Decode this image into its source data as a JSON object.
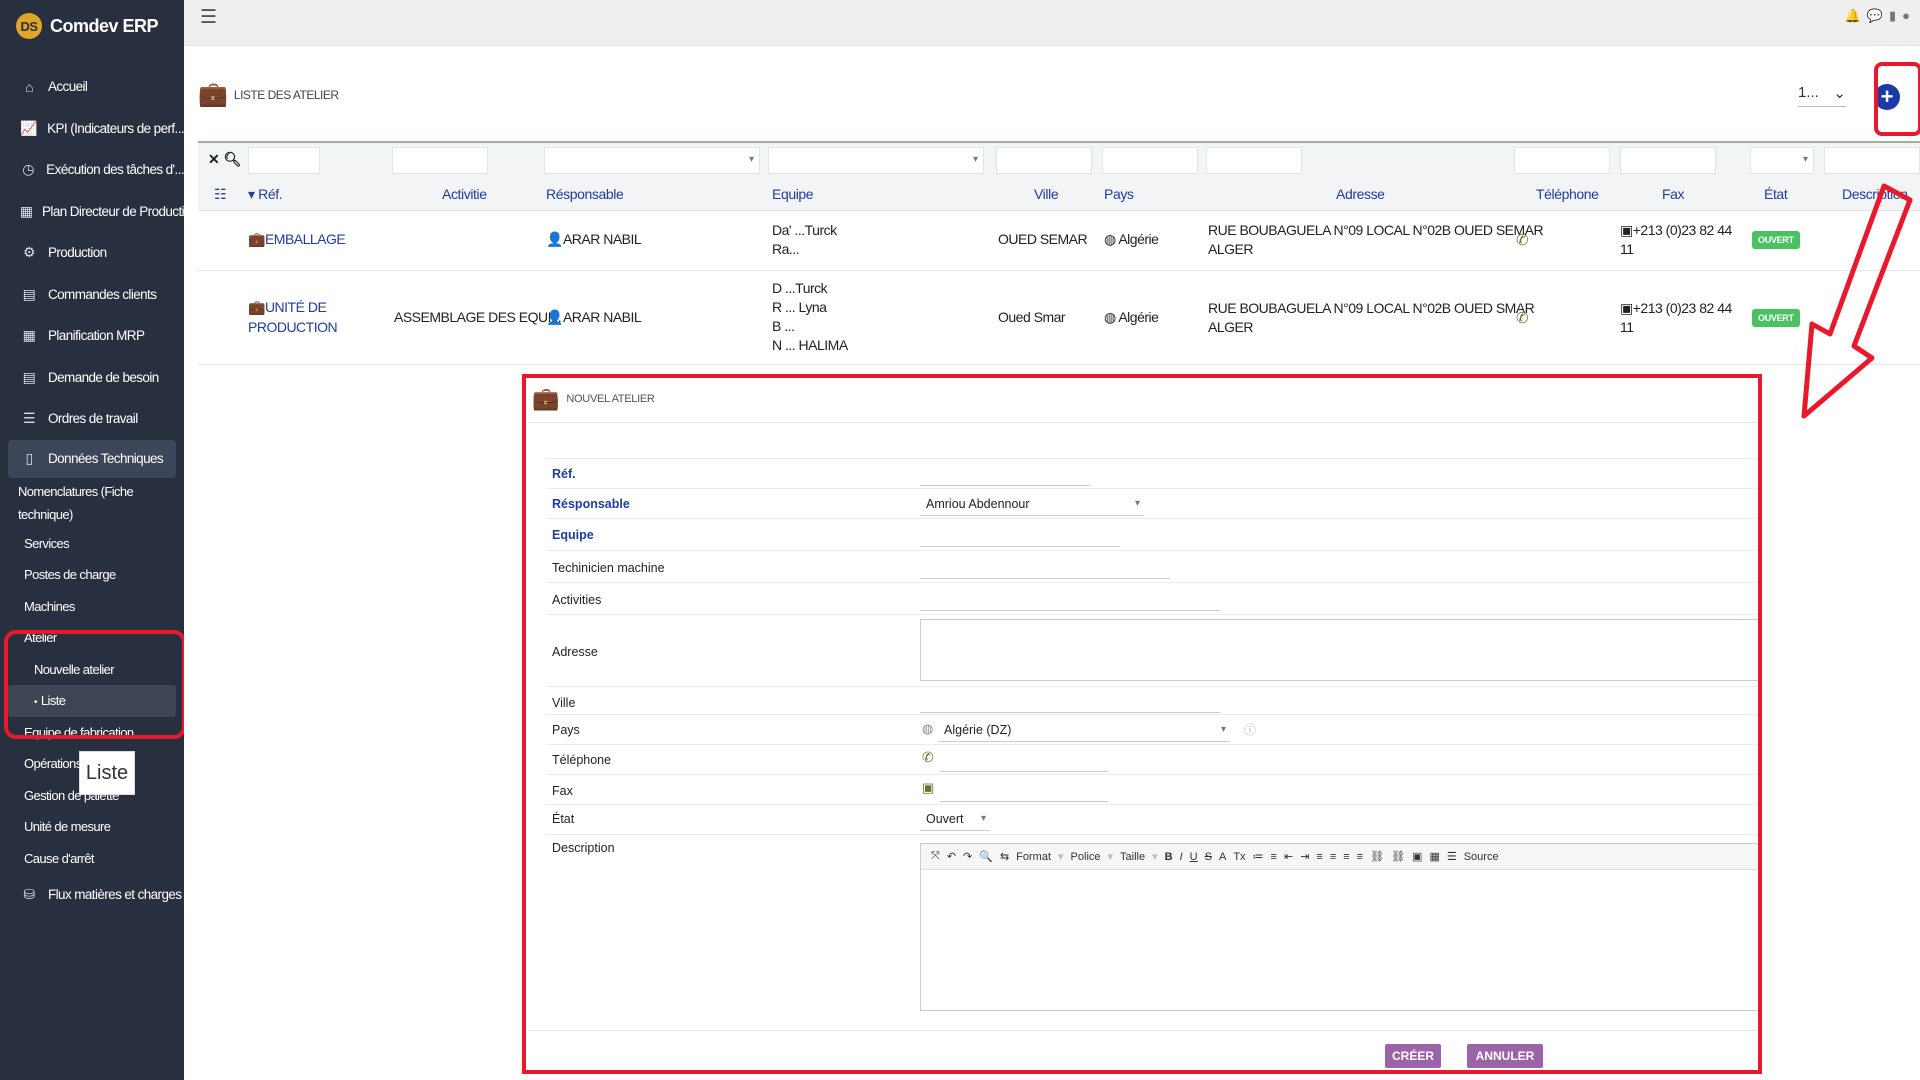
{
  "app": {
    "title": "Comdev ERP",
    "logo_text": "DS"
  },
  "sidebar": {
    "items": [
      {
        "label": "Accueil",
        "icon": "home-icon",
        "glyph": "⌂"
      },
      {
        "label": "KPI (Indicateurs de perf...",
        "icon": "chart-icon",
        "glyph": "📈"
      },
      {
        "label": "Exécution des tâches d'...",
        "icon": "clock-icon",
        "glyph": "◷"
      },
      {
        "label": "Plan Directeur de Producti",
        "icon": "calendar-icon",
        "glyph": "▦"
      },
      {
        "label": "Production",
        "icon": "gears-icon",
        "glyph": "⚙"
      },
      {
        "label": "Commandes clients",
        "icon": "file-icon",
        "glyph": "▤"
      },
      {
        "label": "Planification MRP",
        "icon": "calendar-icon",
        "glyph": "▦"
      },
      {
        "label": "Demande de besoin",
        "icon": "file-icon",
        "glyph": "▤"
      },
      {
        "label": "Ordres de travail",
        "icon": "list-icon",
        "glyph": "☰"
      },
      {
        "label": "Données Techniques",
        "icon": "file-icon",
        "glyph": "▯"
      }
    ],
    "sub_items": {
      "nomenclatures": "Nomenclatures (Fiche technique)",
      "services": "Services",
      "postes": "Postes de charge",
      "machines": "Machines",
      "atelier": "Atelier",
      "nouvelle": "Nouvelle atelier",
      "liste": "Liste",
      "equipe": "Equipe de fabrication",
      "operations": "Opérations",
      "palette": "Gestion de palette",
      "unite": "Unité de mesure",
      "cause": "Cause d'arrêt"
    },
    "last_item": {
      "label": "Flux matières et charges",
      "icon": "boxes-icon",
      "glyph": "⛁"
    },
    "tooltip": "Liste"
  },
  "topbar": {
    "menu_icon": "☰",
    "icons": [
      "bell-icon",
      "chat-icon",
      "battery-icon",
      "user-icon"
    ]
  },
  "page": {
    "title": "LISTE DES ATELIER",
    "pager_value": "1...",
    "add_icon": "plus-circle-icon"
  },
  "table": {
    "columns": [
      "Réf.",
      "Activitie",
      "Résponsable",
      "Equipe",
      "Ville",
      "Pays",
      "Adresse",
      "Téléphone",
      "Fax",
      "État",
      "Description"
    ],
    "rows": [
      {
        "ref": "EMBALLAGE",
        "activitie": "",
        "responsable": "ARAR NABIL",
        "equipe": [
          "Da' ...Turck",
          "Ra..."
        ],
        "ville": "OUED SEMAR",
        "pays": "Algérie",
        "adresse": [
          "RUE BOUBAGUELA N°09 LOCAL N°02B OUED SEMAR",
          "ALGER"
        ],
        "fax": [
          "+213 (0)23 82 44",
          "11"
        ],
        "etat": "OUVERT"
      },
      {
        "ref": [
          "UNITÉ DE",
          "PRODUCTION"
        ],
        "activitie": "ASSEMBLAGE DES EQUI...",
        "responsable": "ARAR NABIL",
        "equipe": [
          "D ...Turck",
          "R ... Lyna",
          "B ...",
          "N ... HALIMA"
        ],
        "ville": "Oued Smar",
        "pays": "Algérie",
        "adresse": [
          "RUE BOUBAGUELA N°09 LOCAL N°02B OUED SMAR",
          "ALGER"
        ],
        "fax": [
          "+213 (0)23 82 44",
          "11"
        ],
        "etat": "OUVERT"
      }
    ]
  },
  "form": {
    "title": "NOUVEL ATELIER",
    "labels": {
      "ref": "Réf.",
      "responsable": "Résponsable",
      "equipe": "Equipe",
      "technicien": "Techinicien machine",
      "activities": "Activities",
      "adresse": "Adresse",
      "ville": "Ville",
      "pays": "Pays",
      "telephone": "Téléphone",
      "fax": "Fax",
      "etat": "État",
      "description": "Description"
    },
    "values": {
      "responsable": "Amriou Abdennour",
      "pays": "Algérie (DZ)",
      "etat": "Ouvert"
    },
    "toolbar": [
      "⤧",
      "↶",
      "↷",
      "🔍",
      "⇆",
      "Format",
      "Police",
      "Taille",
      "B",
      "I",
      "U",
      "S",
      "A",
      "Tx",
      "≔",
      "≡",
      "⇤",
      "⇥",
      "≡",
      "≡",
      "≡",
      "≡",
      "⛓",
      "⛓",
      "▣",
      "▦",
      "☰",
      "Source"
    ],
    "create_label": "CRÉER",
    "cancel_label": "ANNULER"
  }
}
